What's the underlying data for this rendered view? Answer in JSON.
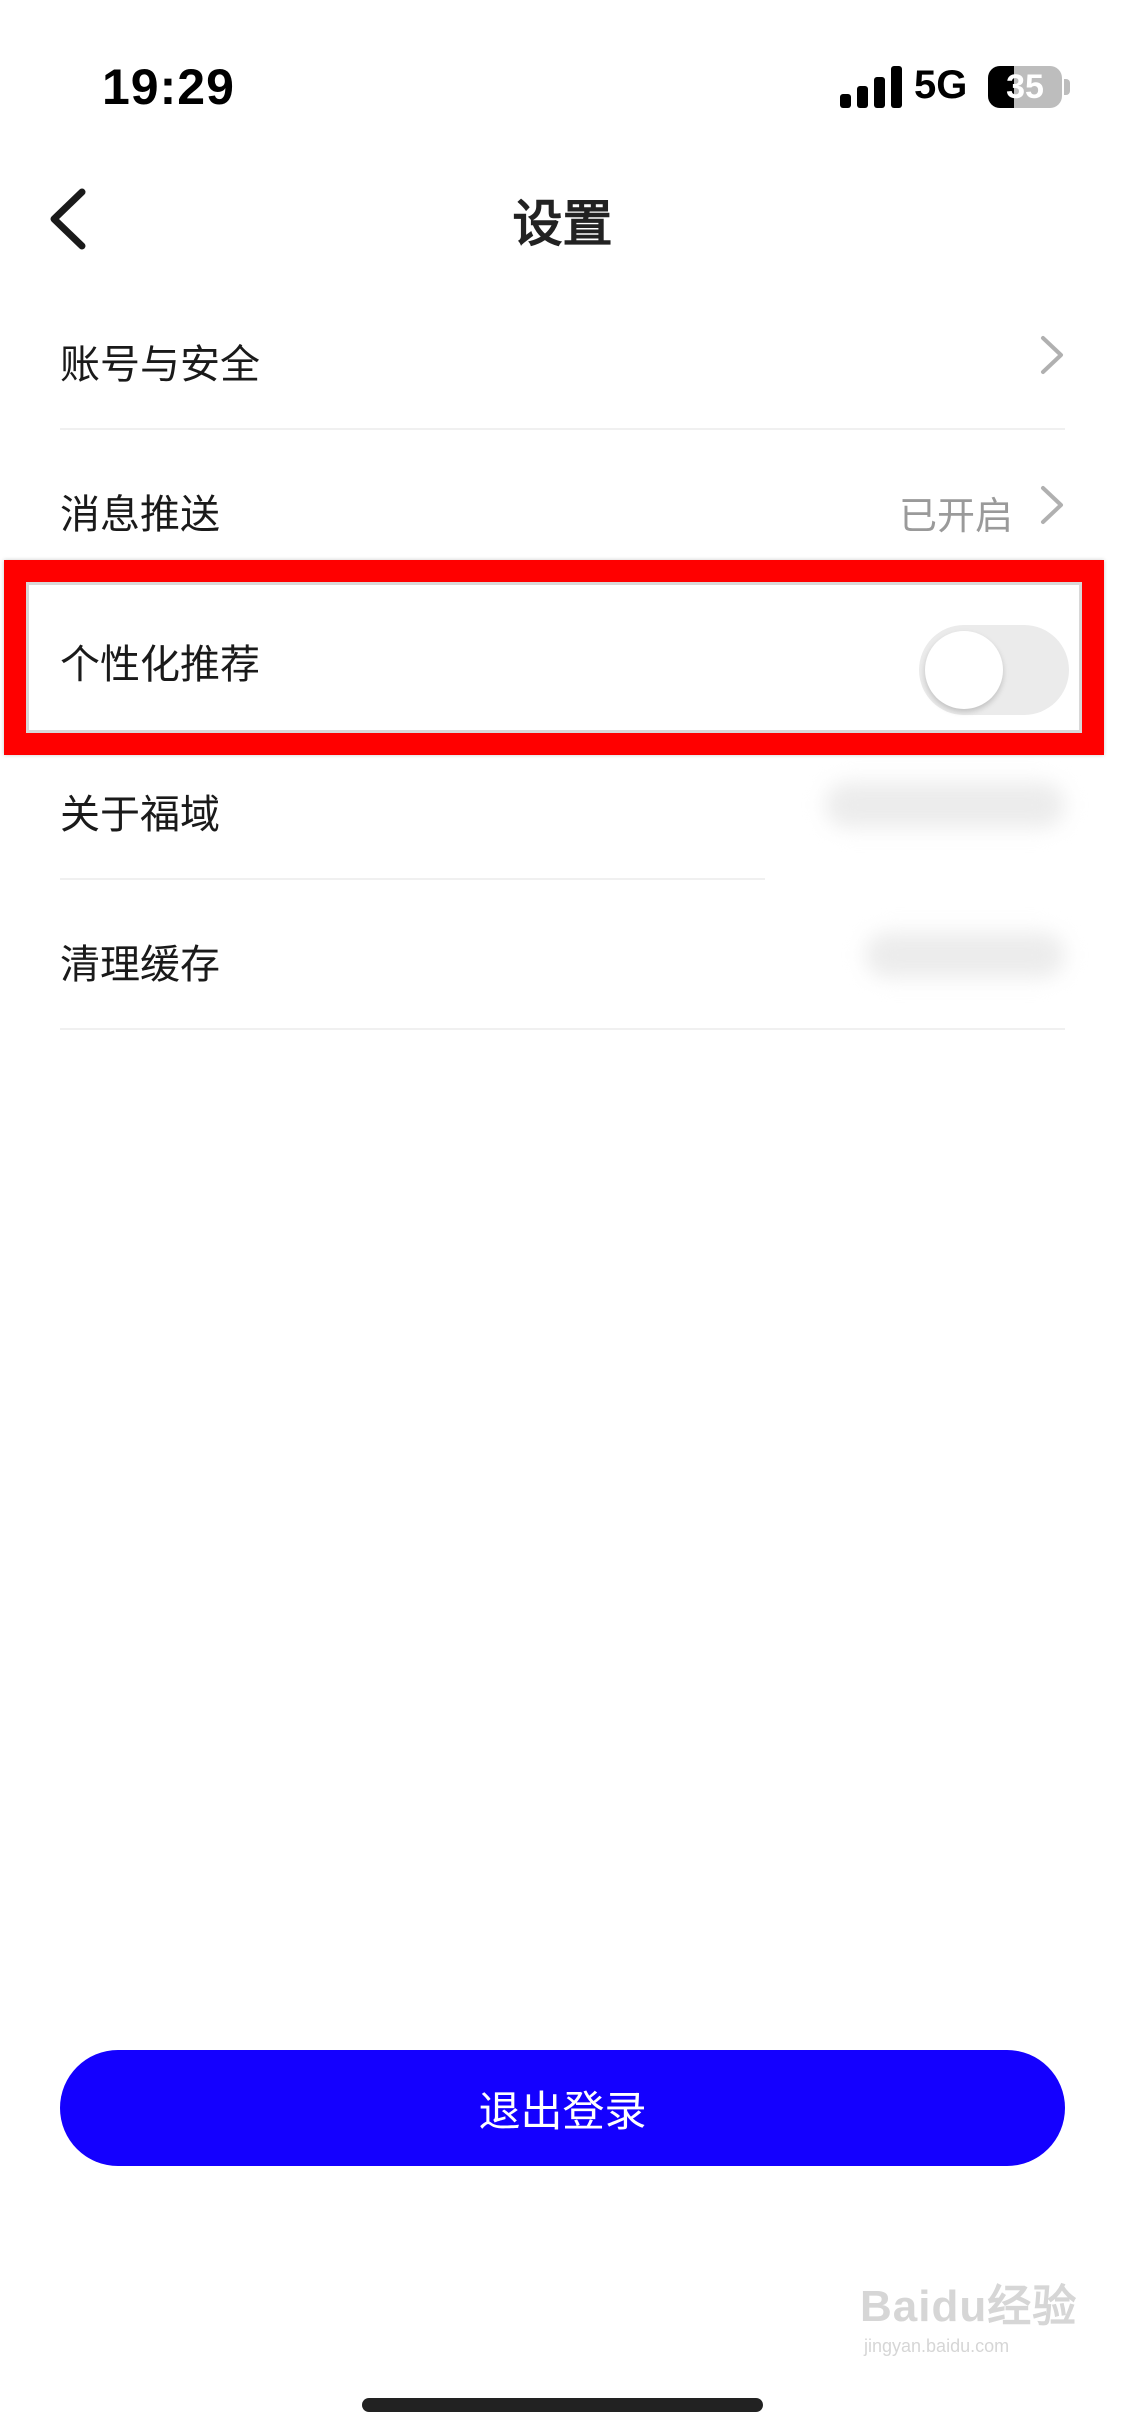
{
  "status_bar": {
    "time": "19:29",
    "network": "5G",
    "battery_percent": "35",
    "battery_level": 0.35
  },
  "nav": {
    "title": "设置",
    "back_icon": "chevron-left-icon"
  },
  "settings": [
    {
      "label": "账号与安全",
      "value": "",
      "control": "chevron"
    },
    {
      "label": "消息推送",
      "value": "已开启",
      "control": "chevron"
    },
    {
      "label": "个性化推荐",
      "value": "",
      "control": "toggle",
      "toggle_on": false,
      "highlighted": true
    },
    {
      "label": "关于福域",
      "value": "",
      "control": "blurred"
    },
    {
      "label": "清理缓存",
      "value": "",
      "control": "blurred"
    }
  ],
  "logout_label": "退出登录",
  "watermark": {
    "brand": "Baidu经验",
    "url": "jingyan.baidu.com"
  },
  "colors": {
    "accent": "#1400ff",
    "highlight_frame": "#ff0000",
    "secondary_text": "#9a9a9a",
    "toggle_off": "#ebebeb"
  }
}
